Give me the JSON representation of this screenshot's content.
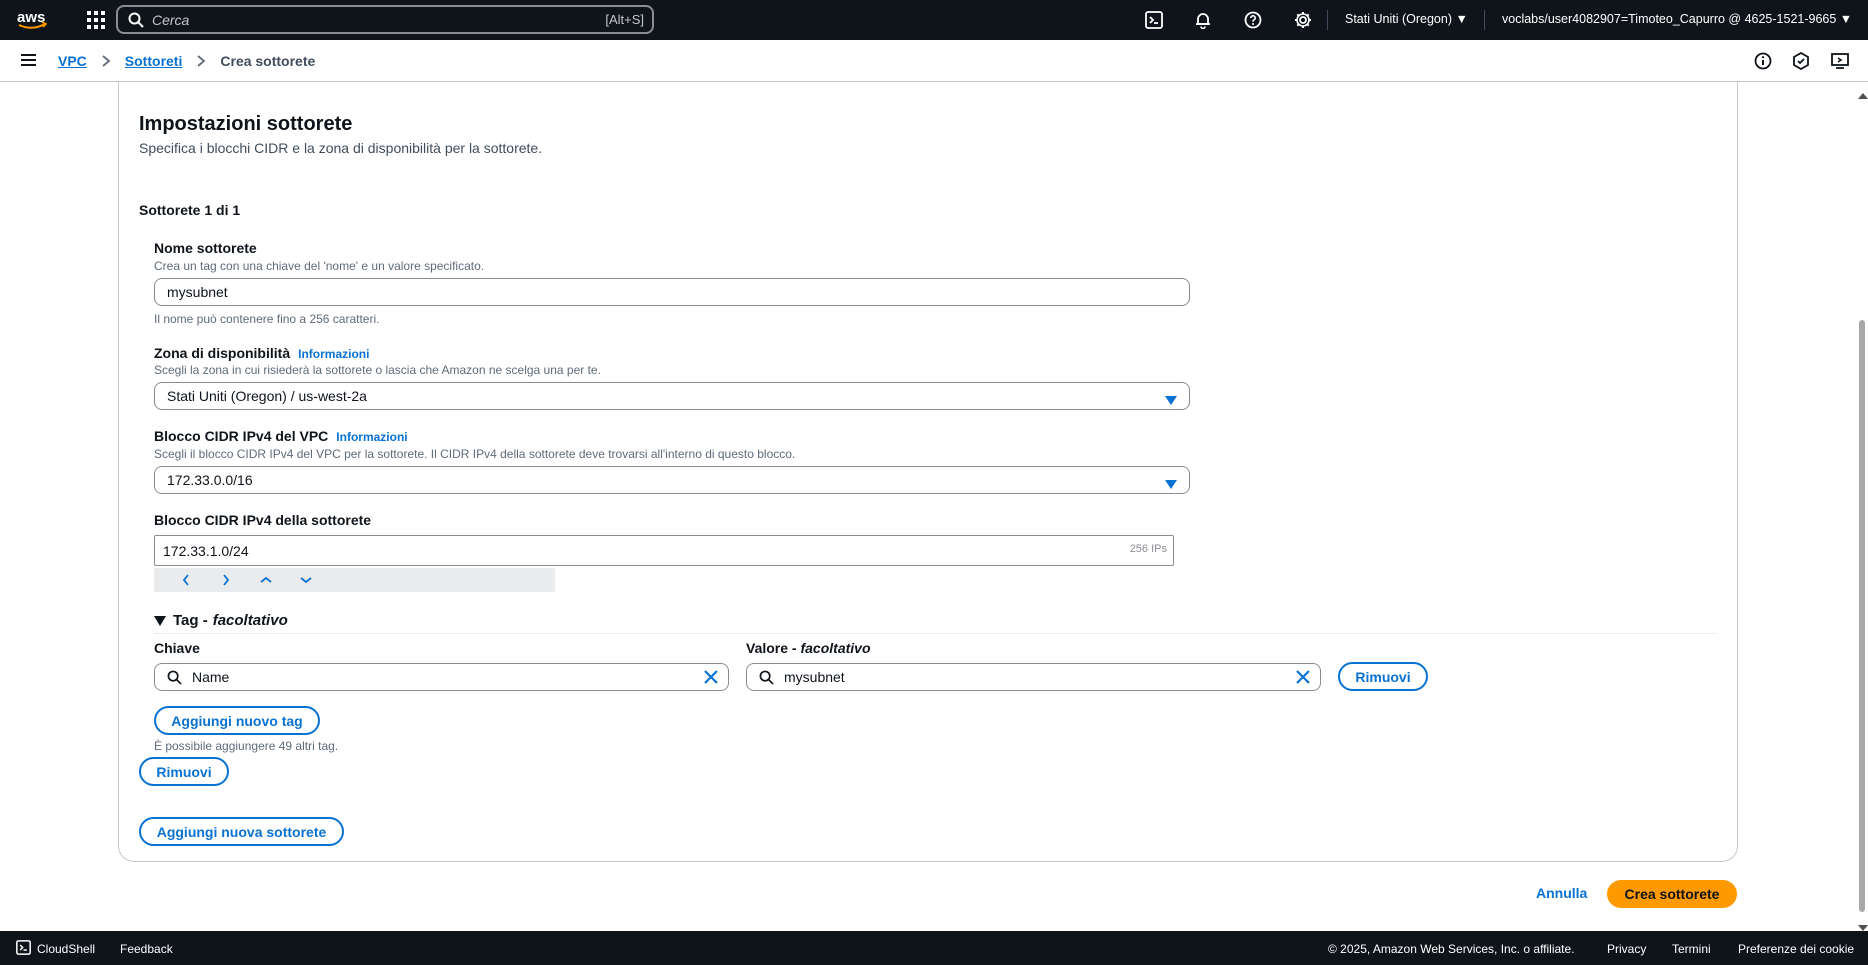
{
  "topnav": {
    "logo_text": "aws",
    "search_placeholder": "Cerca",
    "search_shortcut": "[Alt+S]",
    "region": "Stati Uniti (Oregon) ▼",
    "account": "voclabs/user4082907=Timoteo_Capurro @ 4625-1521-9665 ▼"
  },
  "breadcrumb": {
    "items": [
      "VPC",
      "Sottoreti"
    ],
    "current": "Crea sottorete"
  },
  "section": {
    "title": "Impostazioni sottorete",
    "description": "Specifica i blocchi CIDR e la zona di disponibilità per la sottorete.",
    "subnet_counter": "Sottorete 1 di 1"
  },
  "subnet_name": {
    "label": "Nome sottorete",
    "hint": "Crea un tag con una chiave del 'nome' e un valore specificato.",
    "value": "mysubnet",
    "constraint": "Il nome può contenere fino a 256 caratteri."
  },
  "availability_zone": {
    "label": "Zona di disponibilità",
    "info": "Informazioni",
    "hint": "Scegli la zona in cui risiederà la sottorete o lascia che Amazon ne scelga una per te.",
    "value": "Stati Uniti (Oregon) / us-west-2a"
  },
  "vpc_cidr": {
    "label": "Blocco CIDR IPv4 del VPC",
    "info": "Informazioni",
    "hint": "Scegli il blocco CIDR IPv4 del VPC per la sottorete. Il CIDR IPv4 della sottorete deve trovarsi all'interno di questo blocco.",
    "value": "172.33.0.0/16"
  },
  "subnet_cidr": {
    "label": "Blocco CIDR IPv4 della sottorete",
    "value": "172.33.1.0/24",
    "ips": "256 IPs"
  },
  "tags": {
    "toggle_label": "Tag -",
    "toggle_optional": "facoltativo",
    "key_label": "Chiave",
    "value_label": "Valore -",
    "value_optional": "facoltativo",
    "key": "Name",
    "value": "mysubnet",
    "remove_tag": "Rimuovi",
    "add_tag": "Aggiungi nuovo tag",
    "note": "È possibile aggiungere 49 altri tag."
  },
  "actions": {
    "remove_subnet": "Rimuovi",
    "add_subnet": "Aggiungi nuova sottorete",
    "cancel": "Annulla",
    "create": "Crea sottorete"
  },
  "footer": {
    "cloudshell": "CloudShell",
    "feedback": "Feedback",
    "copyright": "© 2025, Amazon Web Services, Inc. o affiliate.",
    "privacy": "Privacy",
    "terms": "Termini",
    "cookies": "Preferenze dei cookie"
  },
  "colors": {
    "nav_bg": "#0f141a",
    "link": "#0972d3",
    "primary": "#ff9900",
    "border": "#8c8c94"
  }
}
